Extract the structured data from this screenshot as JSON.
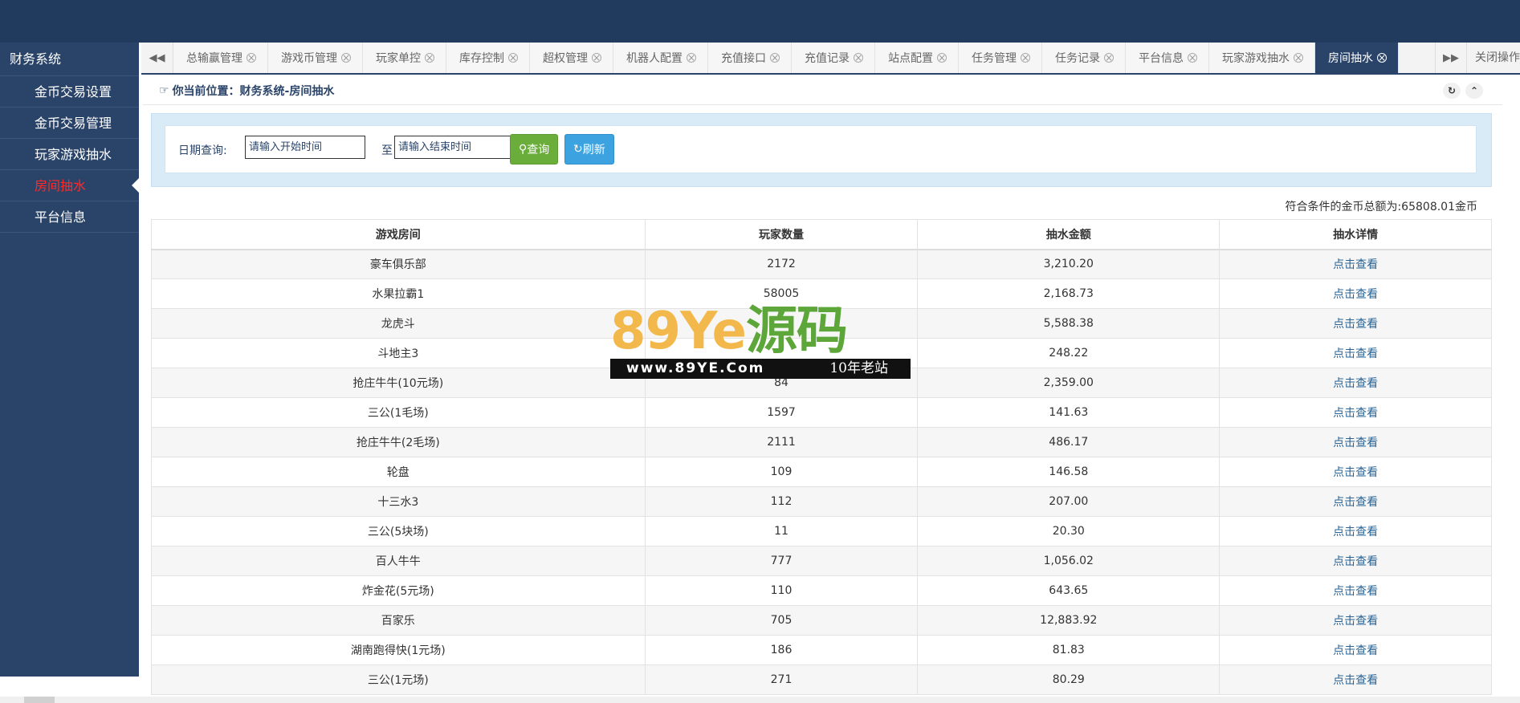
{
  "sidebar": {
    "header": "财务系统",
    "items": [
      {
        "label": "金币交易设置",
        "active": false
      },
      {
        "label": "金币交易管理",
        "active": false
      },
      {
        "label": "玩家游戏抽水",
        "active": false
      },
      {
        "label": "房间抽水",
        "active": true
      },
      {
        "label": "平台信息",
        "active": false
      }
    ]
  },
  "tabs": {
    "items": [
      {
        "label": "总输赢管理",
        "active": false
      },
      {
        "label": "游戏币管理",
        "active": false
      },
      {
        "label": "玩家单控",
        "active": false
      },
      {
        "label": "库存控制",
        "active": false
      },
      {
        "label": "超权管理",
        "active": false
      },
      {
        "label": "机器人配置",
        "active": false
      },
      {
        "label": "充值接口",
        "active": false
      },
      {
        "label": "充值记录",
        "active": false
      },
      {
        "label": "站点配置",
        "active": false
      },
      {
        "label": "任务管理",
        "active": false
      },
      {
        "label": "任务记录",
        "active": false
      },
      {
        "label": "平台信息",
        "active": false
      },
      {
        "label": "玩家游戏抽水",
        "active": false
      },
      {
        "label": "房间抽水",
        "active": true
      }
    ],
    "close_ops": "关闭操作"
  },
  "breadcrumb": {
    "text": "你当前位置：财务系统-房间抽水"
  },
  "query": {
    "date_label": "日期查询:",
    "start_placeholder": "请输入开始时间",
    "to_label": "至",
    "end_placeholder": "请输入结束时间",
    "query_button": "查询",
    "refresh_button": "刷新"
  },
  "total_text": "符合条件的金币总额为:65808.01金币",
  "table": {
    "headers": [
      "游戏房间",
      "玩家数量",
      "抽水金额",
      "抽水详情"
    ],
    "rows": [
      {
        "room": "豪车俱乐部",
        "players": "2172",
        "amount": "3,210.20",
        "detail": "点击查看"
      },
      {
        "room": "水果拉霸1",
        "players": "58005",
        "amount": "2,168.73",
        "detail": "点击查看"
      },
      {
        "room": "龙虎斗",
        "players": "",
        "amount": "5,588.38",
        "detail": "点击查看"
      },
      {
        "room": "斗地主3",
        "players": "",
        "amount": "248.22",
        "detail": "点击查看"
      },
      {
        "room": "抢庄牛牛(10元场)",
        "players": "84",
        "amount": "2,359.00",
        "detail": "点击查看"
      },
      {
        "room": "三公(1毛场)",
        "players": "1597",
        "amount": "141.63",
        "detail": "点击查看"
      },
      {
        "room": "抢庄牛牛(2毛场)",
        "players": "2111",
        "amount": "486.17",
        "detail": "点击查看"
      },
      {
        "room": "轮盘",
        "players": "109",
        "amount": "146.58",
        "detail": "点击查看"
      },
      {
        "room": "十三水3",
        "players": "112",
        "amount": "207.00",
        "detail": "点击查看"
      },
      {
        "room": "三公(5块场)",
        "players": "11",
        "amount": "20.30",
        "detail": "点击查看"
      },
      {
        "room": "百人牛牛",
        "players": "777",
        "amount": "1,056.02",
        "detail": "点击查看"
      },
      {
        "room": "炸金花(5元场)",
        "players": "110",
        "amount": "643.65",
        "detail": "点击查看"
      },
      {
        "room": "百家乐",
        "players": "705",
        "amount": "12,883.92",
        "detail": "点击查看"
      },
      {
        "room": "湖南跑得快(1元场)",
        "players": "186",
        "amount": "81.83",
        "detail": "点击查看"
      },
      {
        "room": "三公(1元场)",
        "players": "271",
        "amount": "80.29",
        "detail": "点击查看"
      }
    ]
  },
  "watermark": {
    "big_digits": "89",
    "big_ye": "Ye",
    "big_cn": "源码",
    "url": "www.89YE.Com",
    "tag": "10年老站"
  },
  "colors": {
    "topbar": "#213b5f",
    "sidebar": "#2a4469",
    "active_side": "#ff2a2a",
    "query_btn": "#6bad3a",
    "refresh_btn": "#3ca2e0",
    "link": "#2a6496"
  }
}
